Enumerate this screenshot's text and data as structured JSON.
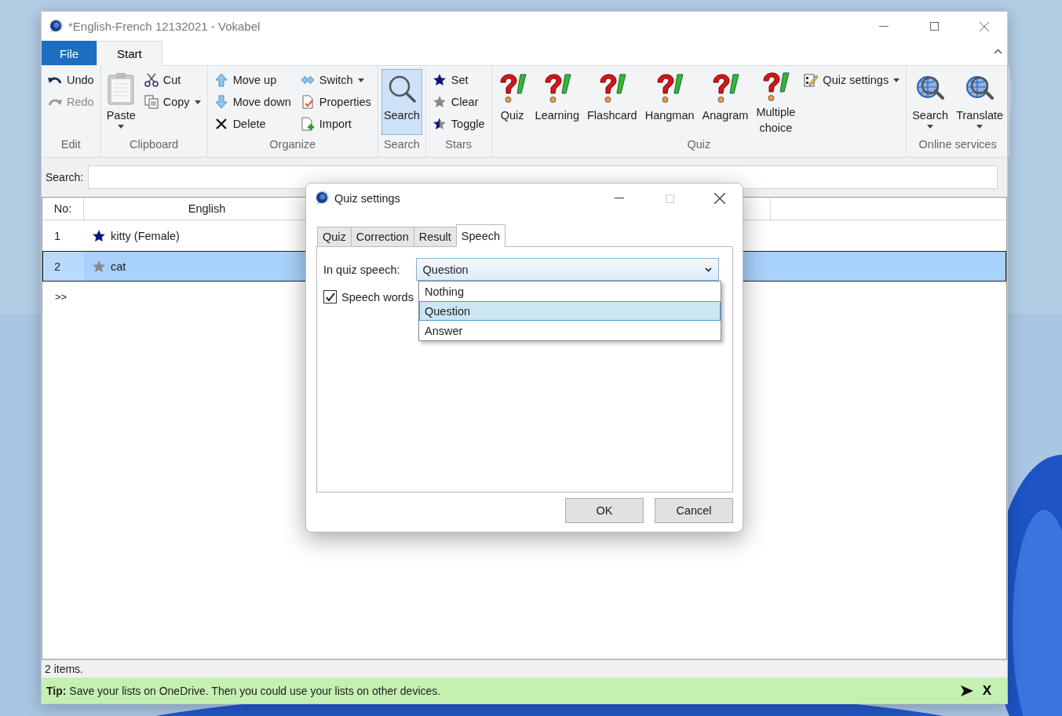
{
  "window": {
    "title": "*English-French 12132021 - Vokabel"
  },
  "ribbon_tabs": [
    {
      "label": "File",
      "kind": "file",
      "selected": false
    },
    {
      "label": "Start",
      "kind": "tab",
      "selected": true
    }
  ],
  "ribbon_groups": [
    {
      "label": "Edit",
      "columns": [
        [
          {
            "label": "Undo",
            "kind": "small",
            "disabled": false
          },
          {
            "label": "Redo",
            "kind": "small",
            "disabled": true
          }
        ]
      ]
    },
    {
      "label": "Clipboard",
      "columns": [
        [
          {
            "label": "Paste",
            "kind": "large",
            "dropdown": true
          }
        ],
        [
          {
            "label": "Cut",
            "kind": "small"
          },
          {
            "label": "Copy",
            "kind": "small",
            "dropdown": true
          }
        ]
      ]
    },
    {
      "label": "Organize",
      "columns": [
        [
          {
            "label": "Move up",
            "kind": "small"
          },
          {
            "label": "Move down",
            "kind": "small"
          },
          {
            "label": "Delete",
            "kind": "small"
          }
        ],
        [
          {
            "label": "Switch",
            "kind": "small",
            "dropdown": true
          },
          {
            "label": "Properties",
            "kind": "small"
          },
          {
            "label": "Import",
            "kind": "small"
          }
        ]
      ]
    },
    {
      "label": "Search",
      "columns": [
        [
          {
            "label": "Search",
            "kind": "large",
            "selected": true
          }
        ]
      ]
    },
    {
      "label": "Stars",
      "columns": [
        [
          {
            "label": "Set",
            "kind": "small"
          },
          {
            "label": "Clear",
            "kind": "small"
          },
          {
            "label": "Toggle",
            "kind": "small"
          }
        ]
      ]
    },
    {
      "label": "Quiz",
      "columns": [
        [
          {
            "label": "Quiz",
            "kind": "large"
          }
        ],
        [
          {
            "label": "Learning",
            "kind": "large"
          }
        ],
        [
          {
            "label": "Flashcard",
            "kind": "large"
          }
        ],
        [
          {
            "label": "Hangman",
            "kind": "large"
          }
        ],
        [
          {
            "label": "Anagram",
            "kind": "large"
          }
        ],
        [
          {
            "label": "Multiple choice",
            "kind": "large"
          }
        ],
        [
          {
            "label": "Quiz settings",
            "kind": "small",
            "dropdown": true
          }
        ]
      ]
    },
    {
      "label": "Online services",
      "columns": [
        [
          {
            "label": "Search",
            "kind": "large",
            "dropdown": true
          }
        ],
        [
          {
            "label": "Translate",
            "kind": "large",
            "dropdown": true
          }
        ]
      ]
    }
  ],
  "search": {
    "label": "Search:"
  },
  "table": {
    "columns": [
      "No:",
      "English"
    ],
    "rows": [
      {
        "no": "1",
        "word": "kitty (Female)",
        "starred": true,
        "selected": false
      },
      {
        "no": "2",
        "word": "cat",
        "starred": false,
        "selected": true
      }
    ],
    "new_row": ">>"
  },
  "status_bar": "2 items.",
  "tip": {
    "text": "**Tip:** Save your lists on OneDrive. Then you could use your lists on other devices.",
    "close": "X"
  },
  "dialog": {
    "title": "Quiz settings",
    "tabs": [
      {
        "label": "Quiz",
        "selected": false
      },
      {
        "label": "Correction",
        "selected": false
      },
      {
        "label": "Result",
        "selected": false
      },
      {
        "label": "Speech",
        "selected": true
      }
    ],
    "speech_label": "In quiz speech:",
    "speech_value": "Question",
    "expanded": true,
    "options": [
      {
        "label": "Nothing",
        "selected": false
      },
      {
        "label": "Question",
        "selected": true
      },
      {
        "label": "Answer",
        "selected": false
      }
    ],
    "checkbox": {
      "label": "Speech words",
      "checked": true
    },
    "buttons": [
      "OK",
      "Cancel"
    ]
  }
}
